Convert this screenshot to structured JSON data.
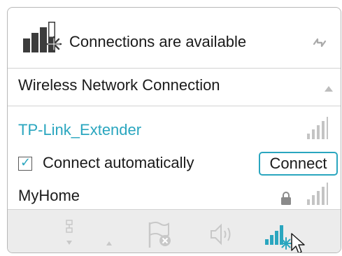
{
  "header": {
    "title": "Connections are available",
    "status_icon": "network-available-icon",
    "refresh_icon": "refresh-icon"
  },
  "section": {
    "title": "Wireless Network Connection",
    "caret_icon": "collapse-caret-icon"
  },
  "networks": [
    {
      "name": "TP-Link_Extender",
      "selected": true,
      "signal_icon": "wifi-signal-icon",
      "connect_automatically_label": "Connect automatically",
      "connect_automatically_checked": true,
      "connect_button_label": "Connect"
    },
    {
      "name": "MyHome",
      "secured": true,
      "lock_icon": "lock-icon",
      "signal_icon": "wifi-signal-icon"
    }
  ],
  "taskbar": {
    "icons": [
      "network-cable-icon",
      "show-hidden-icons-caret",
      "action-center-flag-icon",
      "volume-icon",
      "network-tray-icon"
    ]
  },
  "colors": {
    "accent": "#2aa6bf",
    "text": "#1a1a1a",
    "muted": "#bdbdbd",
    "taskbar": "#ececec"
  }
}
